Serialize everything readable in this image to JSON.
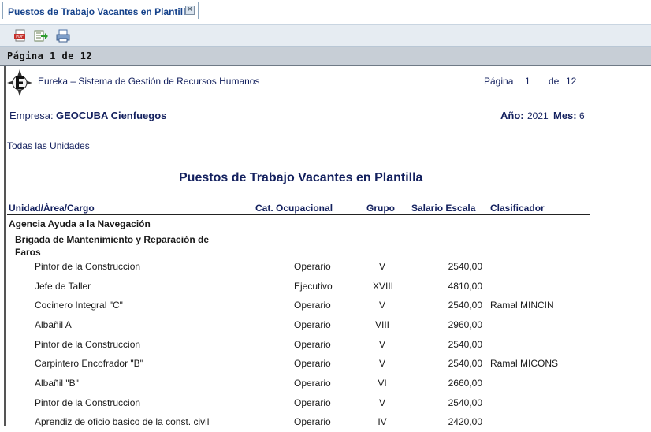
{
  "tab": {
    "title": "Puestos de Trabajo Vacantes en Plantilla",
    "close_icon": "close-icon"
  },
  "toolbar": {
    "buttons": [
      "pdf-export-icon",
      "export-arrow-icon",
      "print-icon"
    ]
  },
  "pager": {
    "text": "Página 1 de 12"
  },
  "report": {
    "app_name": "Eureka – Sistema de Gestión de Recursos Humanos",
    "page_label": "Página",
    "page_current": "1",
    "page_of": "de",
    "page_total": "12",
    "empresa_label": "Empresa:",
    "empresa_value": "GEOCUBA Cienfuegos",
    "ano_label": "Año:",
    "ano_value": "2021",
    "mes_label": "Mes:",
    "mes_value": "6",
    "units": "Todas las Unidades",
    "title": "Puestos de Trabajo Vacantes en Plantilla",
    "columns": [
      "Unidad/Área/Cargo",
      "Cat. Ocupacional",
      "Grupo",
      "Salario Escala",
      "Clasificador"
    ],
    "group_1": "Agencia Ayuda a la Navegación",
    "group_2": "Brigada de Mantenimiento y Reparación de Faros",
    "rows": [
      {
        "cargo": "Pintor de la Construccion",
        "cat": "Operario",
        "grupo": "V",
        "salario": "2540,00",
        "clasificador": ""
      },
      {
        "cargo": "Jefe de Taller",
        "cat": "Ejecutivo",
        "grupo": "XVIII",
        "salario": "4810,00",
        "clasificador": ""
      },
      {
        "cargo": "Cocinero Integral \"C\"",
        "cat": "Operario",
        "grupo": "V",
        "salario": "2540,00",
        "clasificador": "Ramal MINCIN"
      },
      {
        "cargo": "Albañil A",
        "cat": "Operario",
        "grupo": "VIII",
        "salario": "2960,00",
        "clasificador": ""
      },
      {
        "cargo": "Pintor de la Construccion",
        "cat": "Operario",
        "grupo": "V",
        "salario": "2540,00",
        "clasificador": ""
      },
      {
        "cargo": "Carpintero Encofrador \"B\"",
        "cat": "Operario",
        "grupo": "V",
        "salario": "2540,00",
        "clasificador": "Ramal MICONS"
      },
      {
        "cargo": "Albañil \"B\"",
        "cat": "Operario",
        "grupo": "VI",
        "salario": "2660,00",
        "clasificador": ""
      },
      {
        "cargo": "Pintor de la Construccion",
        "cat": "Operario",
        "grupo": "V",
        "salario": "2540,00",
        "clasificador": ""
      },
      {
        "cargo": "Aprendiz de oficio basico de la const. civil",
        "cat": "Operario",
        "grupo": "IV",
        "salario": "2420,00",
        "clasificador": ""
      }
    ]
  },
  "colors": {
    "navy": "#13205e",
    "tab_text": "#15428b",
    "toolbar_bg": "#e6ecf2",
    "pagebar_bg": "#c7ced6"
  }
}
